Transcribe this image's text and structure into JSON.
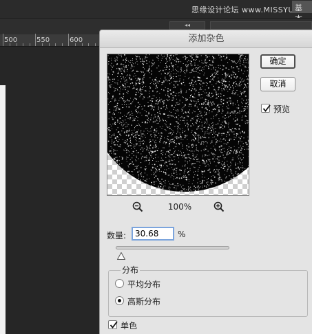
{
  "app": {
    "watermark": "思缘设计论坛 www.MISSYUAN.COM",
    "top_tab": "基本",
    "collapse_glyph": "◂◂"
  },
  "ruler": {
    "labels": [
      "500",
      "550",
      "600"
    ]
  },
  "dialog": {
    "title": "添加杂色",
    "ok_label": "确定",
    "cancel_label": "取消",
    "preview_label": "预览",
    "preview_checked": true,
    "zoom_level": "100%",
    "amount_label": "数量:",
    "amount_value": "30.68",
    "amount_unit": "%",
    "amount_slider_fraction": 0.3068,
    "distribution": {
      "title": "分布",
      "options": [
        {
          "label": "平均分布",
          "selected": false
        },
        {
          "label": "高斯分布",
          "selected": true
        }
      ]
    },
    "monochromatic_label": "单色",
    "monochromatic_checked": true
  }
}
